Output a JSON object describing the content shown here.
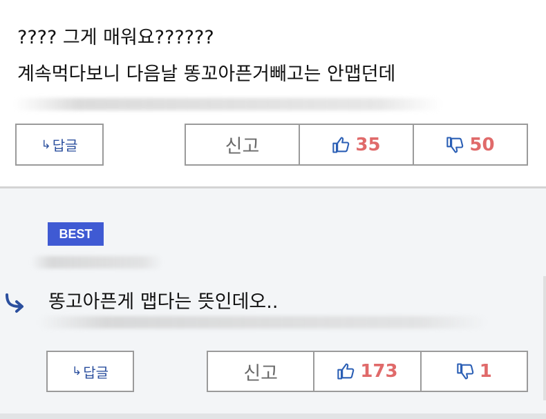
{
  "comments": [
    {
      "lines": [
        "???? 그게 매워요??????",
        "계속먹다보니 다음날 똥꼬아픈거빼고는 안맵던데"
      ],
      "reply_label": "답글",
      "report_label": "신고",
      "likes": "35",
      "dislikes": "50"
    },
    {
      "badge": "BEST",
      "lines": [
        "똥고아픈게 맵다는 뜻인데오.."
      ],
      "reply_label": "답글",
      "report_label": "신고",
      "likes": "173",
      "dislikes": "1"
    }
  ],
  "colors": {
    "accent_blue": "#2b4f9e",
    "badge_blue": "#3f5ad3",
    "count_red": "#e06a6a",
    "border_gray": "#9a9a9a",
    "best_bg": "#f3f5f7"
  },
  "icons": [
    "reply-arrow-icon",
    "thumbs-up-icon",
    "thumbs-down-icon"
  ]
}
